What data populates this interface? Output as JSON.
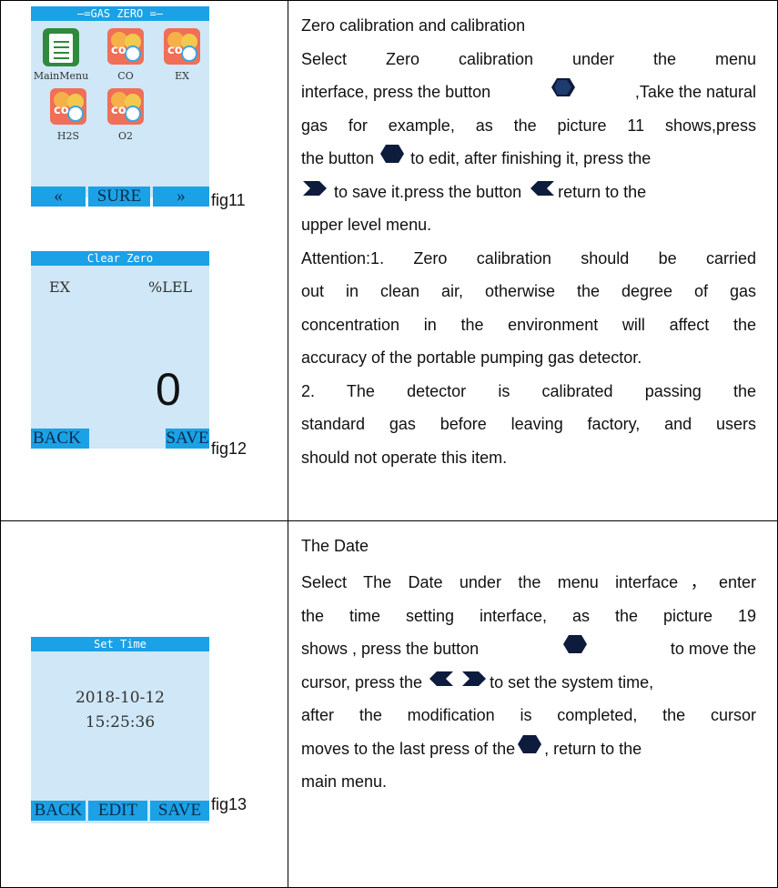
{
  "fig11": {
    "title": "—=GAS ZERO =—",
    "icons": [
      {
        "label": "MainMenu",
        "icon": "clipboard-icon"
      },
      {
        "label": "CO",
        "icon": "gas-bubble-icon"
      },
      {
        "label": "EX",
        "icon": "gas-bubble-icon"
      },
      {
        "label": "H2S",
        "icon": "gas-bubble-icon"
      },
      {
        "label": "O2",
        "icon": "gas-bubble-icon"
      }
    ],
    "prev": "«",
    "sure": "SURE",
    "next": "»",
    "caption": "fig11"
  },
  "fig12": {
    "title": "Clear Zero",
    "gas": "EX",
    "unit": "%LEL",
    "value": "0",
    "back": "BACK",
    "save": "SAVE",
    "caption": "fig12"
  },
  "fig13": {
    "title": "Set Time",
    "date": "2018-10-12",
    "time": "15:25:36",
    "back": "BACK",
    "edit": "EDIT",
    "save": "SAVE",
    "caption": "fig13"
  },
  "section1": {
    "heading": "Zero calibration and calibration",
    "l1": "Select Zero calibration   under the menu",
    "l2a": "interface, press the button ",
    "l2b": ",Take the natural",
    "l3": "gas for example, as the picture 11 shows,press",
    "l4a": "the button",
    "l4b": " to edit, after finishing it, press the",
    "l5a": " to save it.press the button ",
    "l5b": "return to the",
    "l6": "upper level menu.",
    "l7": "Attention:1. Zero calibration should be carried",
    "l8": "out in clean air, otherwise the degree of gas",
    "l9": "concentration in the environment will affect the",
    "l10": "accuracy of the portable pumping gas detector.",
    "l11": "2. The detector is calibrated passing the",
    "l12": "standard gas before leaving factory, and users",
    "l13": "should not operate this item."
  },
  "section2": {
    "heading": "The Date",
    "l1": "Select The Date under the menu interface，enter",
    "l2": "the time setting interface, as the picture 19",
    "l3a": "shows , press the button ",
    "l3b": " to move the",
    "l4a": "cursor, press the ",
    "l4b": "to set the system time,",
    "l5": "after the modification is completed, the cursor",
    "l6a": "moves to the last press of the ",
    "l6b": ", return to the",
    "l7": "main menu."
  },
  "colors": {
    "screen_bg": "#cfe7f6",
    "title_bar": "#1ba1e6",
    "button_icon": "#0d1b3d"
  }
}
